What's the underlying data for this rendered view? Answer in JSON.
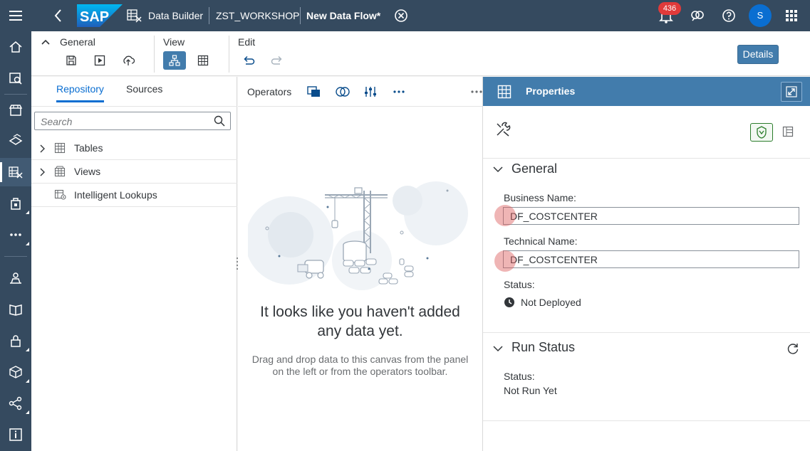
{
  "shell": {
    "breadcrumb_app": "Data Builder",
    "breadcrumb_space": "ZST_WORKSHOP",
    "breadcrumb_flow": "New Data Flow",
    "modified_marker": "*",
    "notification_count": "436",
    "avatar_initial": "S",
    "logo_text": "SAP"
  },
  "toolbar": {
    "general_label": "General",
    "view_label": "View",
    "edit_label": "Edit",
    "details_label": "Details"
  },
  "repository": {
    "tabs": [
      "Repository",
      "Sources"
    ],
    "search_placeholder": "Search",
    "items": [
      {
        "label": "Tables",
        "expandable": true
      },
      {
        "label": "Views",
        "expandable": true
      },
      {
        "label": "Intelligent Lookups",
        "expandable": false
      }
    ]
  },
  "canvas": {
    "operators_label": "Operators",
    "empty_title": "It looks like you haven't added any data yet.",
    "empty_title_line1": "It looks like you haven't added",
    "empty_title_line2": "any data yet.",
    "empty_sub_line1": "Drag and drop data to this canvas from the panel",
    "empty_sub_line2": "on the left or from the operators toolbar."
  },
  "properties": {
    "title": "Properties",
    "general": {
      "title": "General",
      "business_name_label": "Business Name:",
      "business_name_value": "DF_COSTCENTER",
      "technical_name_label": "Technical Name:",
      "technical_name_value": "DF_COSTCENTER",
      "status_label": "Status:",
      "status_value": "Not Deployed"
    },
    "run_status": {
      "title": "Run Status",
      "status_label": "Status:",
      "status_value": "Not Run Yet"
    }
  },
  "colors": {
    "shell": "#354a5f",
    "accent": "#427cac",
    "link": "#0a6ed1",
    "badge": "#e03a3a"
  }
}
